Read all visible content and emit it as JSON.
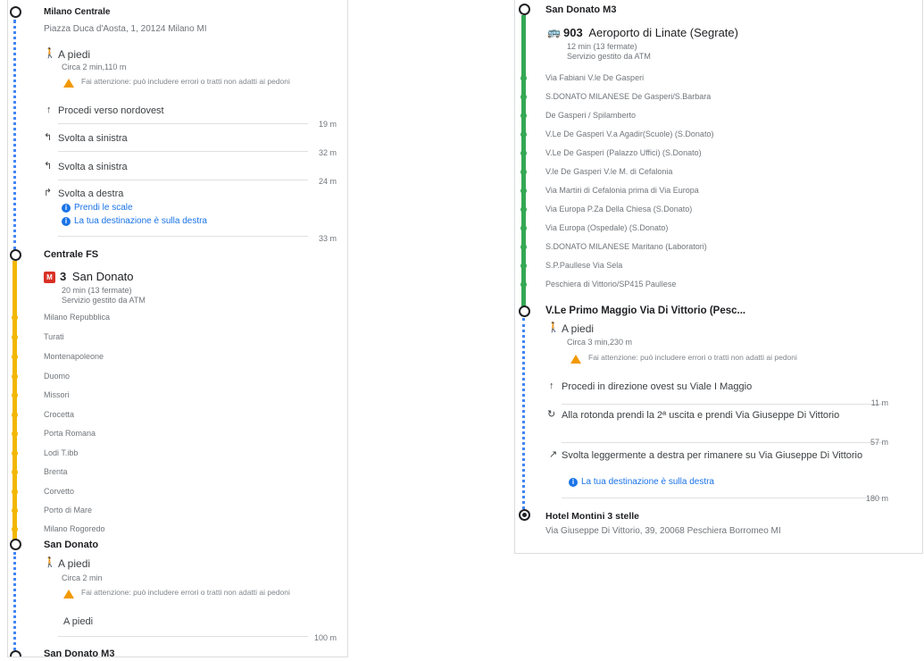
{
  "left": {
    "origin": {
      "name": "Milano Centrale",
      "address": "Piazza Duca d'Aosta, 1, 20124 Milano MI"
    },
    "walk1": {
      "mode": "A piedi",
      "duration": "Circa 2 min,110 m",
      "warning": "Fai attenzione: può includere errori o tratti non adatti ai pedoni",
      "steps": [
        {
          "text": "Procedi verso nordovest",
          "dist": "19 m"
        },
        {
          "text": "Svolta a sinistra",
          "dist": "32 m"
        },
        {
          "text": "Svolta a sinistra",
          "dist": "24 m"
        },
        {
          "text": "Svolta a destra",
          "dist": "33 m"
        }
      ],
      "links": [
        "Prendi le scale",
        "La tua destinazione è sulla destra"
      ]
    },
    "metro": {
      "station": "Centrale FS",
      "badge": "M",
      "line": "3",
      "direction": "San Donato",
      "info1": "20 min (13 fermate)",
      "info2": "Servizio gestito da ATM",
      "stops": [
        "Milano Repubblica",
        "Turati",
        "Montenapoleone",
        "Duomo",
        "Missori",
        "Crocetta",
        "Porta Romana",
        "Lodi T.ibb",
        "Brenta",
        "Corvetto",
        "Porto di Mare",
        "Milano Rogoredo"
      ]
    },
    "walk2": {
      "station": "San Donato",
      "mode": "A piedi",
      "duration": "Circa 2 min",
      "warning": "Fai attenzione: può includere errori o tratti non adatti ai pedoni",
      "step": "A piedi",
      "dist": "100 m",
      "next": "San Donato M3"
    }
  },
  "right": {
    "station": "San Donato M3",
    "bus": {
      "icon": "bus-icon",
      "number": "903",
      "direction": "Aeroporto di Linate (Segrate)",
      "info1": "12 min (13 fermate)",
      "info2": "Servizio gestito da ATM",
      "stops": [
        "Via Fabiani V.le De Gasperi",
        "S.DONATO MILANESE De Gasperi/S.Barbara",
        "De Gasperi / Spilamberto",
        "V.Le De Gasperi V.a Agadir(Scuole) (S.Donato)",
        "V.Le De Gasperi (Palazzo Uffici) (S.Donato)",
        "V.le De Gasperi V.le M. di Cefalonia",
        "Via Martiri di Cefalonia prima di Via Europa",
        "Via Europa P.Za Della Chiesa (S.Donato)",
        "Via Europa (Ospedale) (S.Donato)",
        "S.DONATO MILANESE Maritano (Laboratori)",
        "S.P.Paullese Via Sela",
        "Peschiera di Vittorio/SP415 Paullese"
      ]
    },
    "walk": {
      "station": "V.Le Primo Maggio Via Di Vittorio (Pesc...",
      "mode": "A piedi",
      "duration": "Circa 3 min,230 m",
      "warning": "Fai attenzione: può includere errori o tratti non adatti ai pedoni",
      "steps": [
        {
          "text": "Procedi in direzione ovest su Viale I Maggio",
          "dist": "11 m"
        },
        {
          "text": "Alla rotonda prendi la 2ª uscita e prendi Via Giuseppe Di Vittorio",
          "dist": "57 m"
        },
        {
          "text": "Svolta leggermente a destra per rimanere su Via Giuseppe Di Vittorio",
          "dist": "180 m"
        }
      ],
      "link": "La tua destinazione è sulla destra"
    },
    "destination": {
      "name": "Hotel Montini 3 stelle",
      "address": "Via Giuseppe Di Vittorio, 39, 20068 Peschiera Borromeo MI"
    }
  },
  "colors": {
    "metro_line": "#f2b705",
    "bus_line": "#34a853",
    "walk_dots": "#4285f4",
    "link": "#1a73e8",
    "warning": "#f29900"
  }
}
